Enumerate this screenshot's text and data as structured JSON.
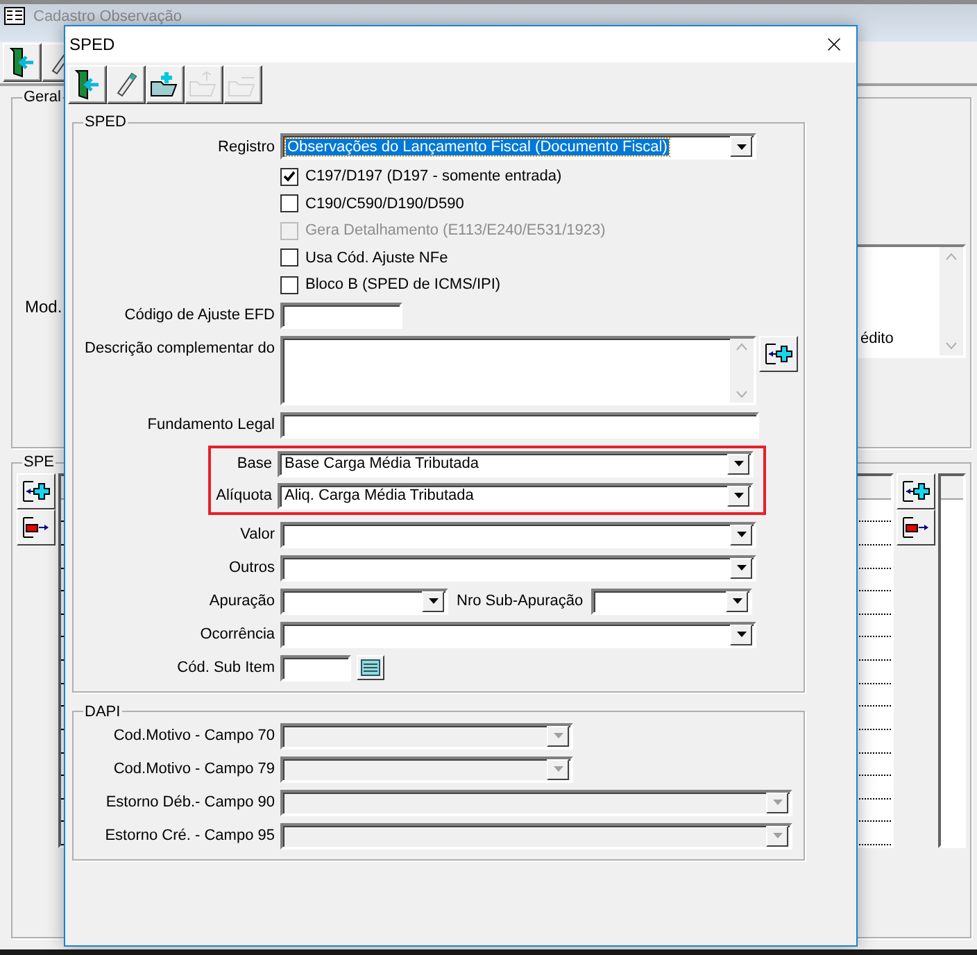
{
  "main_window": {
    "title": "Cadastro Observação",
    "toolbar": [
      {
        "kind": "exit"
      },
      {
        "kind": "eraser"
      }
    ],
    "general_group": {
      "title": "Geral",
      "field_label": "Mod.",
      "list_text": "édito"
    },
    "sped_group": {
      "title": "SPE"
    }
  },
  "dialog": {
    "title": "SPED",
    "toolbar": [
      {
        "kind": "exit",
        "disabled": false
      },
      {
        "kind": "eraser",
        "disabled": false
      },
      {
        "kind": "folder_add",
        "disabled": false
      },
      {
        "kind": "folder_up",
        "disabled": true
      },
      {
        "kind": "folder_minus",
        "disabled": true
      }
    ],
    "sped": {
      "title": "SPED",
      "rows": [
        {
          "kind": "select",
          "label": "Registro",
          "value": "Observações do Lançamento Fiscal (Documento Fiscal)",
          "focused": true
        },
        {
          "kind": "checkbox",
          "label": "C197/D197 (D197 - somente entrada)",
          "checked": true,
          "disabled": false
        },
        {
          "kind": "checkbox",
          "label": "C190/C590/D190/D590",
          "checked": false,
          "disabled": false
        },
        {
          "kind": "checkbox",
          "label": "Gera Detalhamento (E113/E240/E531/1923)",
          "checked": false,
          "disabled": true
        },
        {
          "kind": "checkbox",
          "label": "Usa Cód. Ajuste NFe",
          "checked": false,
          "disabled": false
        },
        {
          "kind": "checkbox",
          "label": "Bloco B (SPED de ICMS/IPI)",
          "checked": false,
          "disabled": false
        },
        {
          "kind": "input_short",
          "label": "Código de Ajuste EFD"
        },
        {
          "kind": "memo",
          "label": "Descrição complementar do"
        },
        {
          "kind": "input",
          "label": "Fundamento Legal"
        },
        {
          "kind": "highlight",
          "rows": [
            {
              "kind": "select",
              "label": "Base",
              "value": "Base Carga Média Tributada",
              "focused": false
            },
            {
              "kind": "select",
              "label": "Alíquota",
              "value": "Aliq. Carga Média Tributada",
              "focused": false
            }
          ]
        },
        {
          "kind": "select",
          "label": "Valor"
        },
        {
          "kind": "select",
          "label": "Outros"
        },
        {
          "kind": "select_pair",
          "label": "Apuração",
          "second_label": "Nro Sub-Apuração"
        },
        {
          "kind": "select",
          "label": "Ocorrência"
        },
        {
          "kind": "input_lookup",
          "label": "Cód. Sub Item"
        }
      ]
    },
    "dapi": {
      "title": "DAPI",
      "rows": [
        {
          "kind": "select_short",
          "label": "Cod.Motivo - Campo 70",
          "disabled": true
        },
        {
          "kind": "select_short",
          "label": "Cod.Motivo - Campo 79",
          "disabled": true
        },
        {
          "kind": "select",
          "label": "Estorno Déb.- Campo 90",
          "disabled": true
        },
        {
          "kind": "select",
          "label": "Estorno Cré. - Campo 95",
          "disabled": true
        }
      ]
    }
  }
}
